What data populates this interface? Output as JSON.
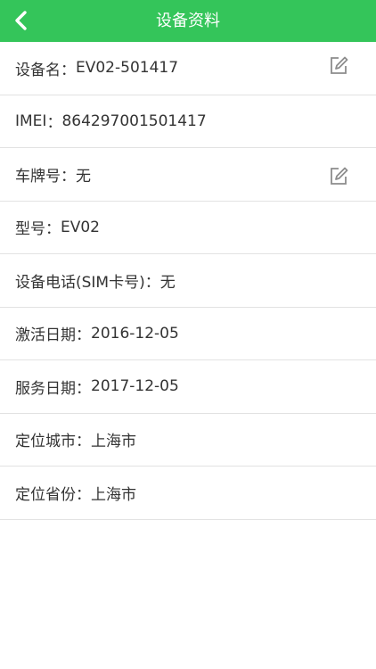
{
  "header": {
    "title": "设备资料",
    "back_icon": "chevron-left-icon",
    "color": "#34c55a"
  },
  "rows": [
    {
      "label": "设备名",
      "value": "EV02-501417",
      "editable": true
    },
    {
      "label": "IMEI",
      "value": "864297001501417",
      "editable": false
    },
    {
      "label": "车牌号",
      "value": "无",
      "editable": true
    },
    {
      "label": "型号",
      "value": "EV02",
      "editable": false
    },
    {
      "label": "设备电话(SIM卡号)",
      "value": "无",
      "editable": false
    },
    {
      "label": "激活日期",
      "value": "2016-12-05",
      "editable": false
    },
    {
      "label": "服务日期",
      "value": "2017-12-05",
      "editable": false
    },
    {
      "label": "定位城市",
      "value": "上海市",
      "editable": false
    },
    {
      "label": "定位省份",
      "value": "上海市",
      "editable": false
    }
  ],
  "separator": "：",
  "edit_icon": "edit-icon"
}
